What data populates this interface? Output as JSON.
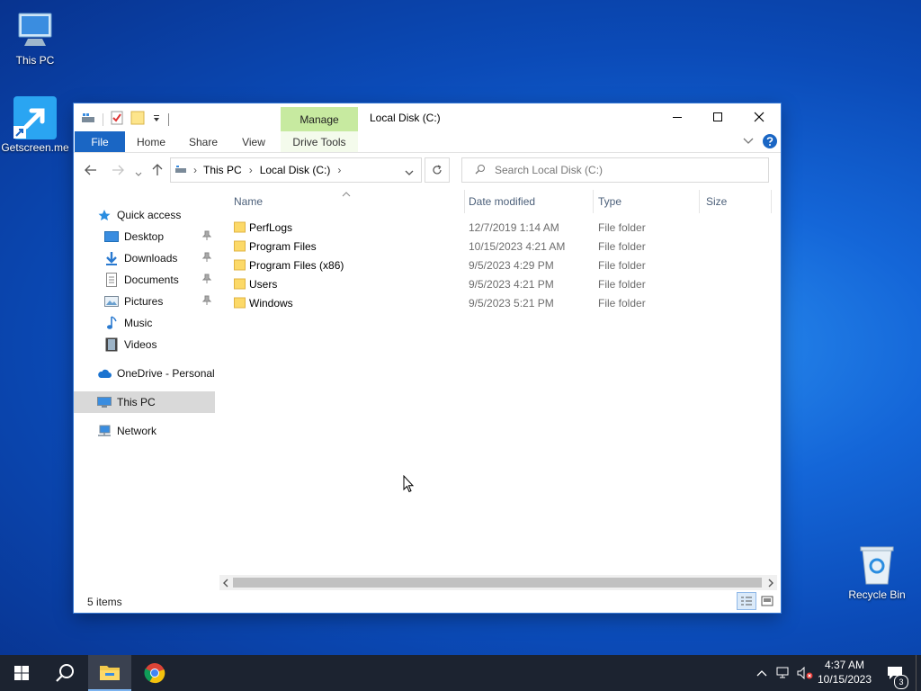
{
  "desktop": {
    "icons": [
      {
        "label": "This PC",
        "icon": "monitor-icon"
      },
      {
        "label": "Getscreen.me",
        "icon": "shortcut-arrow-icon"
      },
      {
        "label": "Recycle Bin",
        "icon": "recycle-bin-icon"
      }
    ]
  },
  "window": {
    "title": "Local Disk (C:)",
    "contextual_tab": "Manage",
    "ribbon_tabs": [
      "File",
      "Home",
      "Share",
      "View",
      "Drive Tools"
    ],
    "address": {
      "segments": [
        "This PC",
        "Local Disk (C:)"
      ]
    },
    "search": {
      "placeholder": "Search Local Disk (C:)"
    },
    "nav": {
      "quick_access": "Quick access",
      "items": [
        "Desktop",
        "Downloads",
        "Documents",
        "Pictures",
        "Music",
        "Videos"
      ],
      "onedrive": "OneDrive - Personal",
      "this_pc": "This PC",
      "network": "Network"
    },
    "columns": [
      "Name",
      "Date modified",
      "Type",
      "Size"
    ],
    "files": [
      {
        "name": "PerfLogs",
        "date": "12/7/2019 1:14 AM",
        "type": "File folder"
      },
      {
        "name": "Program Files",
        "date": "10/15/2023 4:21 AM",
        "type": "File folder"
      },
      {
        "name": "Program Files (x86)",
        "date": "9/5/2023 4:29 PM",
        "type": "File folder"
      },
      {
        "name": "Users",
        "date": "9/5/2023 4:21 PM",
        "type": "File folder"
      },
      {
        "name": "Windows",
        "date": "9/5/2023 5:21 PM",
        "type": "File folder"
      }
    ],
    "status": "5 items"
  },
  "taskbar": {
    "time": "4:37 AM",
    "date": "10/15/2023",
    "notifications": "3"
  },
  "colors": {
    "file_tab": "#1a66c4",
    "manage_tab": "#c7eaa0",
    "taskbar": "#1c2330",
    "selection": "#d9d9d9"
  }
}
